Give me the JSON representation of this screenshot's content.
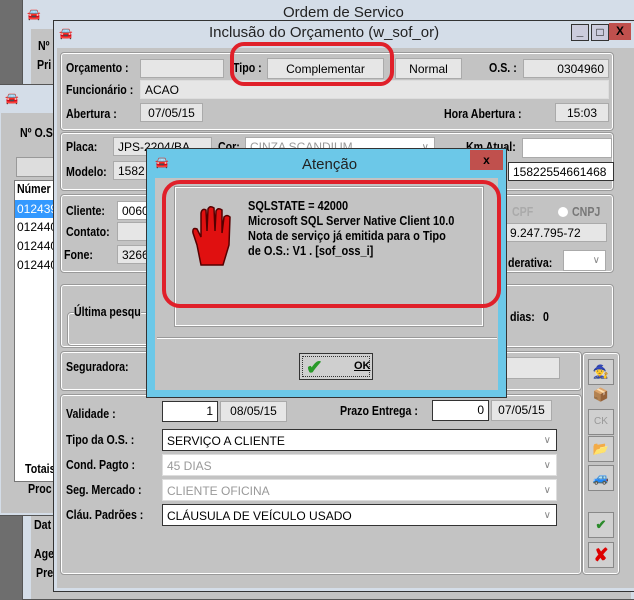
{
  "back_window": {
    "title": "Ordem de Servico",
    "no_label": "Nº",
    "pri_label": "Pri",
    "totais_label": "Totais",
    "proc_label": "Proc",
    "dat_label": "Dat",
    "age_label": "Age",
    "pre_label": "Pre"
  },
  "list_window": {
    "no_os_label": "Nº O.S",
    "list_header": "Númer",
    "rows": [
      "012439",
      "012440",
      "012440",
      "012440"
    ]
  },
  "main_window": {
    "title": "Inclusão do Orçamento (w_sof_or)",
    "orcamento_label": "Orçamento :",
    "orcamento_value": "",
    "tipo_label": "Tipo :",
    "tipo_complementar": "Complementar",
    "tipo_normal": "Normal",
    "os_label": "O.S. :",
    "os_value": "0304960",
    "funcionario_label": "Funcionário :",
    "funcionario_value": "ACAO",
    "abertura_label": "Abertura :",
    "abertura_value": "07/05/15",
    "hora_abertura_label": "Hora Abertura :",
    "hora_abertura_value": "15:03",
    "placa_label": "Placa:",
    "placa_value": "JPS-2204/BA",
    "cor_label": "Cor:",
    "cor_value": "CINZA SCANDIUM",
    "km_label": "Km Atual:",
    "km_value": "",
    "modelo_label": "Modelo:",
    "modelo_value": "1582",
    "chassi_value": "15822554661468",
    "cliente_label": "Cliente:",
    "cliente_value": "0060",
    "cpf_label": "CPF",
    "cnpj_label": "CNPJ",
    "contato_label": "Contato:",
    "doc_value": "9.247.795-72",
    "fone_label": "Fone:",
    "fone_value": "3266",
    "federativa_label": "derativa:",
    "ultima_label": "Última pesqu",
    "dias_label": "dias:",
    "dias_value": "0",
    "seguradora_label": "Seguradora:",
    "validade_label": "Validade :",
    "validade_value": "1",
    "validade_date": "08/05/15",
    "prazo_label": "Prazo Entrega :",
    "prazo_value": "0",
    "prazo_date": "07/05/15",
    "tipo_os_label": "Tipo da O.S. :",
    "tipo_os_value": "SERVIÇO A CLIENTE",
    "cond_label": "Cond. Pagto :",
    "cond_value": "45 DIAS",
    "seg_label": "Seg. Mercado :",
    "seg_value": "CLIENTE OFICINA",
    "clau_label": "Cláu. Padrões :",
    "clau_value": "CLÁUSULA DE VEÍCULO USADO"
  },
  "dialog": {
    "title": "Atenção",
    "lines": [
      "SQLSTATE = 42000",
      "Microsoft SQL Server Native Client 10.0",
      "Nota de serviço já emitida para o Tipo",
      "de O.S.: V1 . [sof_oss_i]"
    ],
    "ok_label": "OK",
    "icon": "stop-hand-icon"
  },
  "colors": {
    "annotation": "#e0202a",
    "dialog_titlebar": "#6cc8e8",
    "close": "#c0504d",
    "selection": "#3399ff"
  }
}
